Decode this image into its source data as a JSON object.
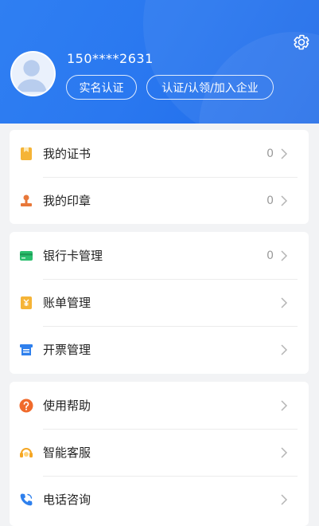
{
  "profile": {
    "phone": "150****2631",
    "verify_label": "实名认证",
    "company_label": "认证/认领/加入企业"
  },
  "groups": [
    {
      "items": [
        {
          "label": "我的证书",
          "count": "0"
        },
        {
          "label": "我的印章",
          "count": "0"
        }
      ]
    },
    {
      "items": [
        {
          "label": "银行卡管理",
          "count": "0"
        },
        {
          "label": "账单管理",
          "count": ""
        },
        {
          "label": "开票管理",
          "count": ""
        }
      ]
    },
    {
      "items": [
        {
          "label": "使用帮助",
          "count": ""
        },
        {
          "label": "智能客服",
          "count": ""
        },
        {
          "label": "电话咨询",
          "count": ""
        }
      ]
    }
  ],
  "colors": {
    "header": "#2a78f0",
    "certificate": "#f5b437",
    "seal": "#e8783a",
    "bank_card": "#2bbf6e",
    "bill": "#f5b437",
    "invoice": "#2f80ed",
    "help": "#f06a2b",
    "service": "#f5a623",
    "phone": "#2f80ed"
  },
  "icons": [
    "gear-icon",
    "certificate-icon",
    "seal-icon",
    "bank-card-icon",
    "bill-icon",
    "invoice-icon",
    "help-icon",
    "customer-service-icon",
    "phone-icon",
    "chevron-right-icon"
  ]
}
